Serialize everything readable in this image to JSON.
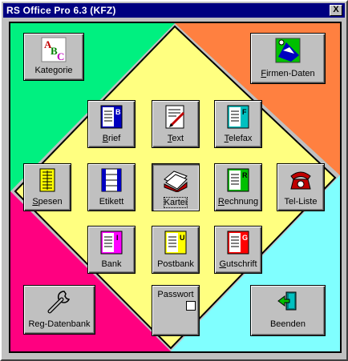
{
  "window": {
    "title": "RS Office Pro 6.3 (KFZ)",
    "close_glyph": "X"
  },
  "colors": {
    "green": "#00f080",
    "orange": "#ff8040",
    "magenta": "#ff0080",
    "cyan": "#80ffff",
    "yellow": "#ffff80",
    "face": "#c0c0c0",
    "titlebar": "#000080"
  },
  "buttons": {
    "kategorie": {
      "u": "",
      "rest": "Kategorie",
      "icon": "abc-icon"
    },
    "firmen": {
      "u": "F",
      "rest": "irmen-Daten",
      "icon": "company-icon"
    },
    "brief": {
      "u": "B",
      "rest": "rief",
      "badge": "B",
      "icon": "letter-doc-icon"
    },
    "text": {
      "u": "T",
      "rest": "ext",
      "icon": "text-edit-icon"
    },
    "telefax": {
      "u": "T",
      "rest": "elefax",
      "badge": "F",
      "icon": "fax-doc-icon"
    },
    "spesen": {
      "u": "S",
      "rest": "pesen",
      "icon": "expenses-icon"
    },
    "etikett": {
      "u": "",
      "rest": "Etikett",
      "icon": "label-icon"
    },
    "kartei": {
      "u": "",
      "rest": "Kartei",
      "icon": "card-index-icon"
    },
    "rechnung": {
      "u": "R",
      "rest": "echnung",
      "badge": "R",
      "icon": "invoice-doc-icon"
    },
    "telliste": {
      "u": "",
      "rest": "Tel-Liste",
      "icon": "telephone-icon"
    },
    "bank": {
      "u": "",
      "rest": "Bank",
      "badge": "I",
      "icon": "bank-doc-icon"
    },
    "postbank": {
      "u": "",
      "rest": "Postbank",
      "badge": "U",
      "icon": "postbank-doc-icon"
    },
    "gutschrift": {
      "u": "G",
      "rest": "utschrift",
      "badge": "G",
      "icon": "credit-doc-icon"
    },
    "regdatenbank": {
      "u": "",
      "rest": "Reg-Datenbank",
      "icon": "wrench-icon"
    },
    "passwort": {
      "label": "Passwort",
      "checked": false
    },
    "beenden": {
      "u": "",
      "rest": "Beenden",
      "icon": "exit-icon"
    }
  }
}
